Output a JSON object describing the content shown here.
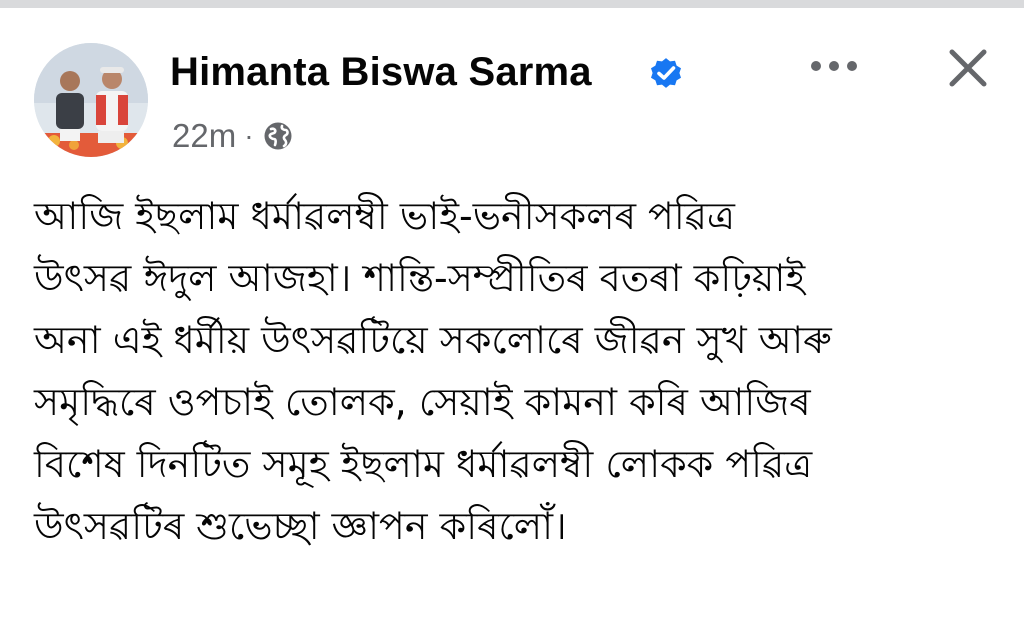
{
  "post": {
    "author": "Himanta Biswa Sarma",
    "verified": true,
    "timestamp": "22m",
    "separator": "·",
    "audience_icon": "globe-icon",
    "text_lines": [
      "আজি ইছলাম ধৰ্মাৱলম্বী ভাই-ভনীসকলৰ পৱিত্ৰ",
      "উৎসৱ ঈদুল আজহা। শান্তি-সম্প্ৰীতিৰ বতৰা কঢ়িয়াই",
      "অনা এই ধৰ্মীয় উৎসৱটিয়ে সকলোৰে জীৱন সুখ আৰু",
      "সমৃদ্ধিৰে ওপচাই তোলক, সেয়াই কামনা কৰি আজিৰ",
      "বিশেষ দিনটিত সমূহ ইছলাম ধৰ্মাৱলম্বী লোকক পৱিত্ৰ",
      "উৎসৱটিৰ শুভেচ্ছা জ্ঞাপন কৰিলোঁ।"
    ]
  },
  "header": {
    "more_icon": "more-dots-icon",
    "close_icon": "close-icon"
  },
  "colors": {
    "verified_blue": "#1877f2",
    "secondary_text": "#65676b",
    "primary_text": "#050505",
    "icon_gray": "#65676b"
  }
}
